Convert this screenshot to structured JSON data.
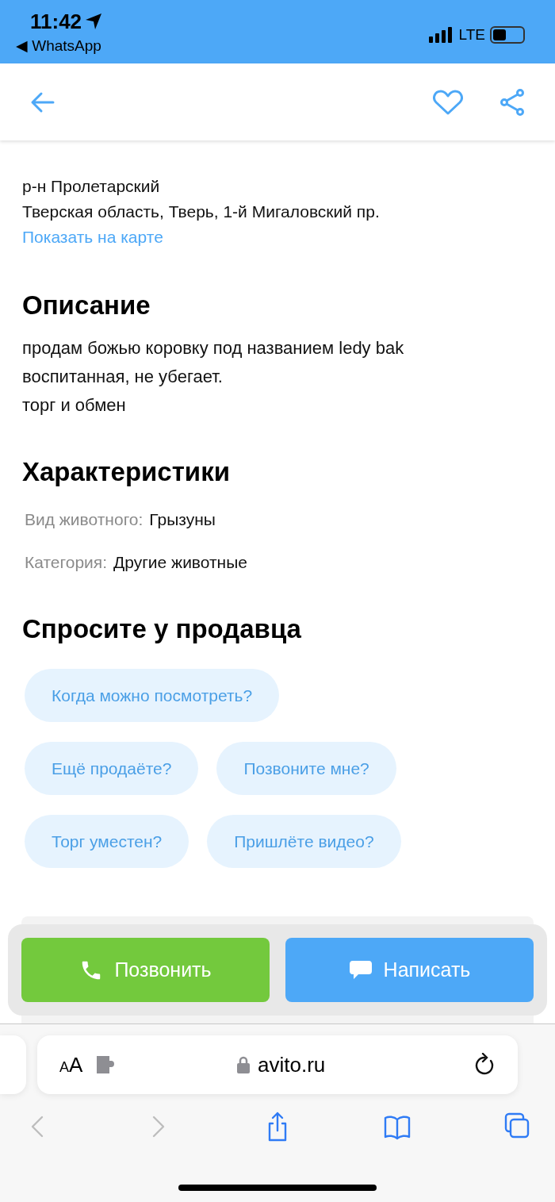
{
  "status_bar": {
    "time": "11:42",
    "back_app": "◀ WhatsApp",
    "network": "LTE"
  },
  "header": {
    "favorite": false
  },
  "address": {
    "lines": [
      "р-н Пролетарский",
      "Тверская область, Тверь, 1-й Мигаловский пр."
    ],
    "map_link": "Показать на карте"
  },
  "description": {
    "title": "Описание",
    "lines": [
      "продам божью коровку под названием ledy bak",
      "воспитанная, не убегает.",
      "торг и обмен"
    ]
  },
  "characteristics": {
    "title": "Характеристики",
    "rows": [
      {
        "label": "Вид животного:",
        "value": "Грызуны"
      },
      {
        "label": "Категория:",
        "value": "Другие животные"
      }
    ]
  },
  "ask_seller": {
    "title": "Спросите у продавца",
    "rows": [
      [
        "Когда можно посмотреть?"
      ],
      [
        "Ещё продаёте?",
        "Позвоните мне?"
      ],
      [
        "Торг уместен?",
        "Пришлёте видео?"
      ]
    ]
  },
  "actions": [
    {
      "kind": "call",
      "label": "Позвонить"
    },
    {
      "kind": "message",
      "label": "Написать"
    }
  ],
  "browser": {
    "text_size": "AA",
    "url": "avito.ru",
    "nav": [
      {
        "kind": "back",
        "disabled": true
      },
      {
        "kind": "forward",
        "disabled": true
      },
      {
        "kind": "share",
        "disabled": false
      },
      {
        "kind": "bookmarks",
        "disabled": false
      },
      {
        "kind": "tabs",
        "disabled": false
      }
    ]
  }
}
